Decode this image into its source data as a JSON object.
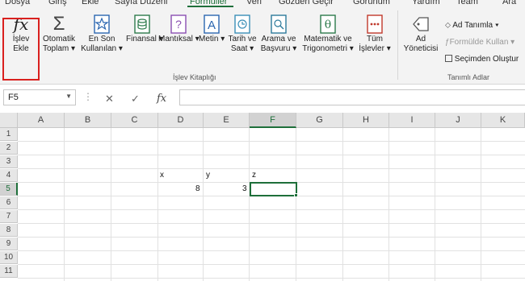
{
  "menu": {
    "items": [
      {
        "label": "Dosya"
      },
      {
        "label": "Giriş"
      },
      {
        "label": "Ekle"
      },
      {
        "label": "Sayfa Düzeni"
      },
      {
        "label": "Formüller"
      },
      {
        "label": "Veri"
      },
      {
        "label": "Gözden Geçir"
      },
      {
        "label": "Görünüm"
      },
      {
        "label": "Yardım"
      },
      {
        "label": "Team"
      },
      {
        "label": "Ara"
      }
    ],
    "active": "Formüller"
  },
  "ribbon": {
    "insert_function": {
      "line1": "İşlev",
      "line2": "Ekle"
    },
    "autosum": {
      "line1": "Otomatik",
      "line2": "Toplam ▾"
    },
    "recent": {
      "line1": "En Son",
      "line2": "Kullanılan ▾"
    },
    "financial": {
      "line1": "Finansal ▾"
    },
    "logical": {
      "line1": "Mantıksal ▾"
    },
    "text": {
      "line1": "Metin ▾"
    },
    "datetime": {
      "line1": "Tarih ve",
      "line2": "Saat ▾"
    },
    "lookup": {
      "line1": "Arama ve",
      "line2": "Başvuru ▾"
    },
    "math": {
      "line1": "Matematik ve",
      "line2": "Trigonometri ▾"
    },
    "more": {
      "line1": "Tüm",
      "line2": "İşlevler ▾"
    },
    "group_library": "İşlev Kitaplığı",
    "name_manager": {
      "line1": "Ad",
      "line2": "Yöneticisi"
    },
    "define_name": "Ad Tanımla  ▾",
    "use_in_formula": "Formülde Kullan ▾",
    "create_from_selection": "Seçimden Oluştur",
    "group_names": "Tanımlı Adlar"
  },
  "formula_bar": {
    "name_box": "F5",
    "fx_label": "fx",
    "formula": ""
  },
  "sheet": {
    "columns": [
      "A",
      "B",
      "C",
      "D",
      "E",
      "F",
      "G",
      "H",
      "I",
      "J",
      "K"
    ],
    "selected_column": "F",
    "rows": [
      "1",
      "2",
      "3",
      "4",
      "5",
      "6",
      "7",
      "8",
      "9",
      "10",
      "11"
    ],
    "selected_row": "5",
    "cells": {
      "D4": "x",
      "E4": "y",
      "F4": "z",
      "D5": "8",
      "E5": "3"
    }
  },
  "colors": {
    "accent": "#1e6f3a",
    "highlight": "#d9201e"
  }
}
